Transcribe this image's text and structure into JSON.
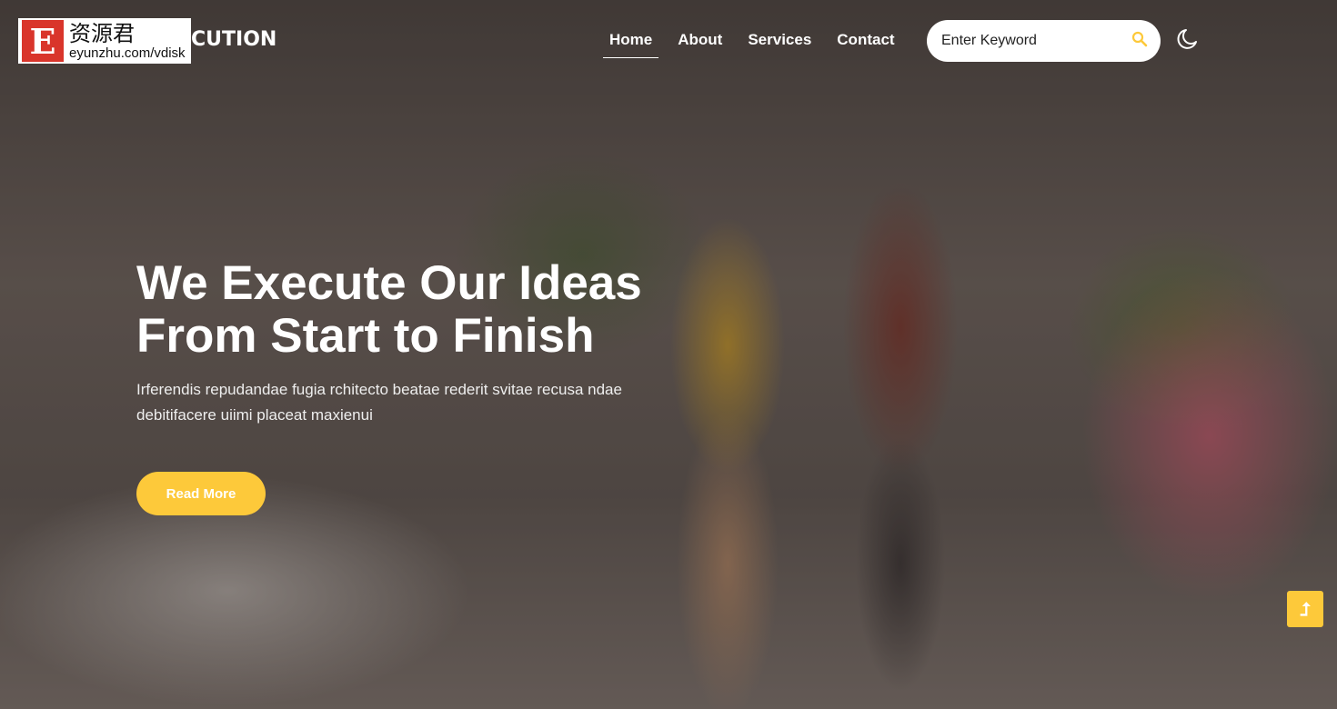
{
  "logo": {
    "letter": "E",
    "cn": "资源君",
    "url": "eyunzhu.com/vdisk"
  },
  "brand": "CUTION",
  "nav": [
    {
      "label": "Home",
      "active": true
    },
    {
      "label": "About"
    },
    {
      "label": "Services"
    },
    {
      "label": "Contact"
    }
  ],
  "search": {
    "placeholder": "Enter Keyword",
    "icon": "search-icon"
  },
  "theme_toggle": {
    "icon": "moon-icon"
  },
  "hero": {
    "title_line1": "We Execute Our Ideas",
    "title_line2": "From Start to Finish",
    "text": "Irferendis repudandae fugia rchitecto beatae rederit svitae recusa ndae debitifacere uiimi placeat maxienui",
    "button": "Read More"
  },
  "scroll_top": {
    "icon": "arrow-up-icon",
    "glyph": "⮥"
  },
  "colors": {
    "accent": "#fdc93a"
  }
}
